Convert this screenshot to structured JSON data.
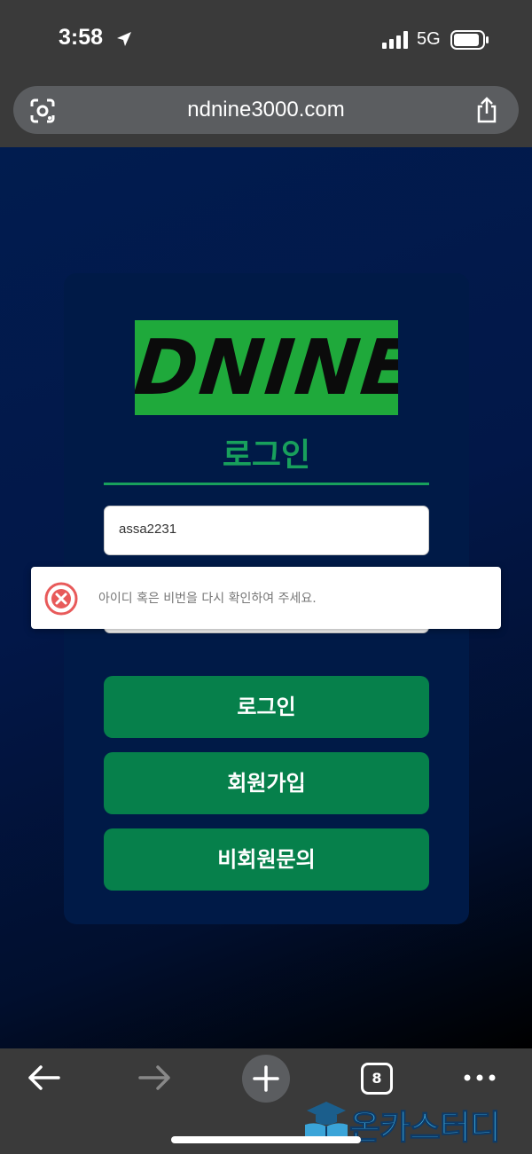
{
  "status_bar": {
    "time": "3:58",
    "network": "5G"
  },
  "browser": {
    "url": "ndnine3000.com",
    "tab_count": "8"
  },
  "brand": {
    "logo_text": "DNINE"
  },
  "login": {
    "title": "로그인",
    "id_value": "assa2231",
    "login_button": "로그인",
    "join_button": "회원가입",
    "inquiry_button": "비회원문의"
  },
  "toast": {
    "message": "아이디 혹은 비번을 다시 확인하여 주세요.",
    "accent": "#e85a5a"
  },
  "watermark": {
    "text": "온카스터디"
  },
  "colors": {
    "brand_green": "#1fa93b",
    "button_green": "#06804b",
    "title_green": "#18a05c",
    "card_bg": "#001a47"
  }
}
